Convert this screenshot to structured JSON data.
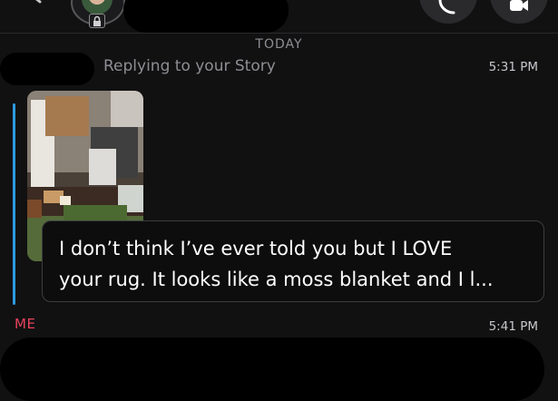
{
  "header": {
    "avatar_icon": "bitmoji-avatar",
    "lock_icon": "lock-icon",
    "call_icon": "phone-icon",
    "video_icon": "video-call-icon"
  },
  "chat": {
    "day_separator": "TODAY",
    "messages": [
      {
        "context": "Replying to your Story",
        "time": "5:31 PM",
        "text_line1": "I don’t think I’ve ever told you but I LOVE",
        "text_line2": "your rug. It looks like a moss blanket and I l...",
        "reply_bar_color": "#2e9ae0"
      },
      {
        "sender": "ME",
        "sender_color": "#e8425c",
        "time": "5:41 PM"
      }
    ]
  }
}
